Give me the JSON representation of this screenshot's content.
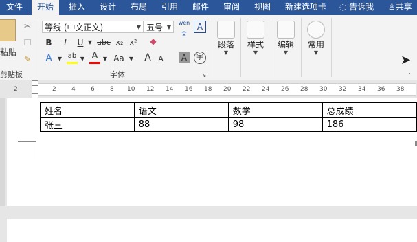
{
  "tabs": [
    "文件",
    "开始",
    "插入",
    "设计",
    "布局",
    "引用",
    "邮件",
    "审阅",
    "视图",
    "新建选项卡"
  ],
  "tell_me": "告诉我",
  "share": "共享",
  "clipboard": {
    "paste_label": "粘贴",
    "group_label": "剪贴板"
  },
  "font": {
    "family": "等线 (中文正文)",
    "size": "五号",
    "phonetic": "wén",
    "bold": "B",
    "italic": "I",
    "underline": "U",
    "strike": "abc",
    "sub": "x₂",
    "sup": "x²",
    "highlight": "ab",
    "color": "A",
    "case": "Aa",
    "grow": "A",
    "shrink": "A",
    "shade": "A",
    "enclose": "字",
    "group_label": "字体"
  },
  "paragraph_label": "段落",
  "styles_label": "样式",
  "editing_label": "编辑",
  "common_label": "常用",
  "ruler": [
    "2",
    "2",
    "4",
    "6",
    "8",
    "10",
    "12",
    "14",
    "16",
    "18",
    "20",
    "22",
    "24",
    "26",
    "28",
    "30",
    "32",
    "34",
    "36",
    "38"
  ],
  "table": [
    [
      "姓名",
      "语文",
      "数学",
      "总成绩"
    ],
    [
      "张三",
      "88",
      "98",
      "186"
    ]
  ],
  "colors": {
    "accent": "#2b579a",
    "highlight": "#ffff00",
    "font_color": "#ff0000"
  }
}
